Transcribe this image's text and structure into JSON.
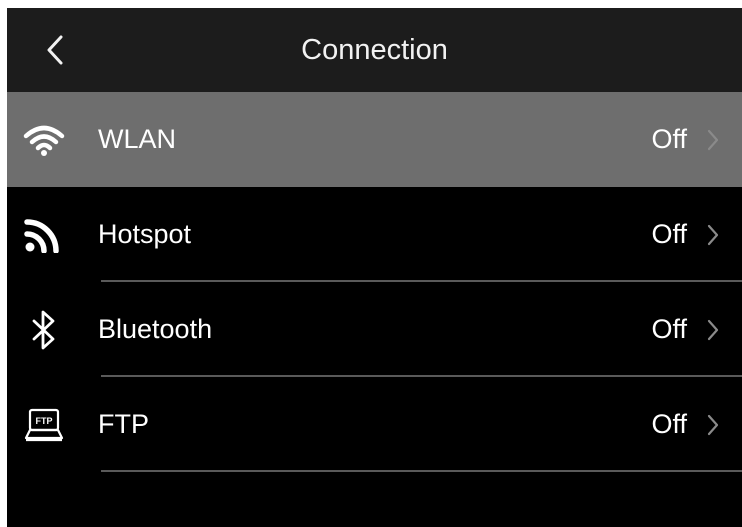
{
  "header": {
    "title": "Connection",
    "back_icon": "chevron-left-icon"
  },
  "colors": {
    "header_bg": "#1c1c1c",
    "screen_bg": "#000000",
    "selected_row_bg": "#6e6e6e",
    "text": "#ffffff",
    "chevron": "#8a8a8a"
  },
  "items": [
    {
      "id": "wlan",
      "label": "WLAN",
      "value": "Off",
      "icon": "wifi-icon",
      "selected": true
    },
    {
      "id": "hotspot",
      "label": "Hotspot",
      "value": "Off",
      "icon": "hotspot-icon",
      "selected": false
    },
    {
      "id": "bluetooth",
      "label": "Bluetooth",
      "value": "Off",
      "icon": "bluetooth-icon",
      "selected": false
    },
    {
      "id": "ftp",
      "label": "FTP",
      "value": "Off",
      "icon": "ftp-icon",
      "icon_text": "FTP",
      "selected": false
    }
  ]
}
